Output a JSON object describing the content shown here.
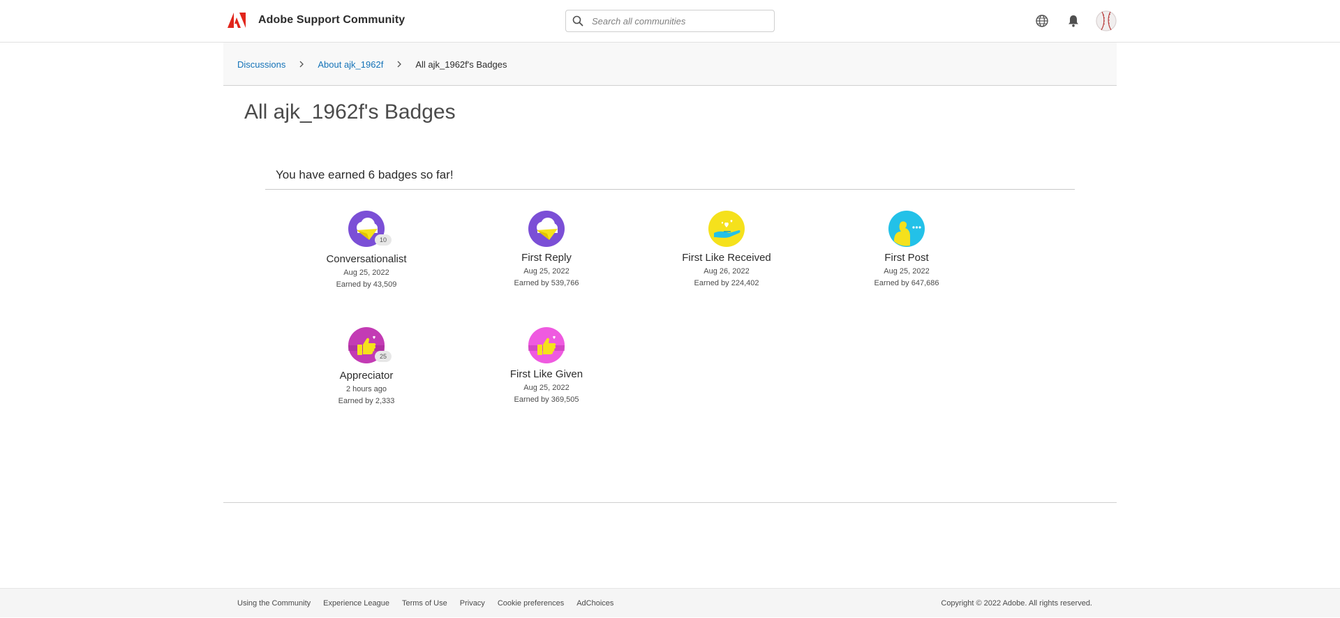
{
  "header": {
    "brand_name": "Adobe Support Community",
    "search_placeholder": "Search all communities",
    "icons": [
      "adobe-logo-icon",
      "search-icon",
      "globe-icon",
      "bell-icon",
      "avatar"
    ]
  },
  "breadcrumb": {
    "items": [
      {
        "label": "Discussions"
      },
      {
        "label": "About ajk_1962f"
      },
      {
        "label": "All ajk_1962f's Badges"
      }
    ]
  },
  "page": {
    "title": "All ajk_1962f's Badges",
    "earned_summary": "You have earned 6 badges so far!"
  },
  "badges": [
    {
      "name": "Conversationalist",
      "date": "Aug 25, 2022",
      "earned": "Earned by 43,509",
      "count": "10",
      "icon": "conversationalist-badge-icon"
    },
    {
      "name": "First Reply",
      "date": "Aug 25, 2022",
      "earned": "Earned by 539,766",
      "icon": "first-reply-badge-icon"
    },
    {
      "name": "First Like Received",
      "date": "Aug 26, 2022",
      "earned": "Earned by 224,402",
      "icon": "first-like-received-badge-icon"
    },
    {
      "name": "First Post",
      "date": "Aug 25, 2022",
      "earned": "Earned by 647,686",
      "icon": "first-post-badge-icon"
    },
    {
      "name": "Appreciator",
      "date": "2 hours ago",
      "earned": "Earned by 2,333",
      "count": "25",
      "icon": "appreciator-badge-icon"
    },
    {
      "name": "First Like Given",
      "date": "Aug 25, 2022",
      "earned": "Earned by 369,505",
      "icon": "first-like-given-badge-icon"
    }
  ],
  "footer": {
    "links": [
      "Using the Community",
      "Experience League",
      "Terms of Use",
      "Privacy",
      "Cookie preferences",
      "AdChoices"
    ],
    "copyright": "Copyright © 2022 Adobe. All rights reserved."
  },
  "colors": {
    "link": "#1473b8",
    "adobe_red": "#e1251b",
    "purple_badge": "#7b4fd6",
    "yellow_badge": "#f5e11c",
    "cyan_badge": "#23c1e8",
    "magenta_badge": "#c33bb4",
    "pink_badge": "#ef5ae0"
  }
}
